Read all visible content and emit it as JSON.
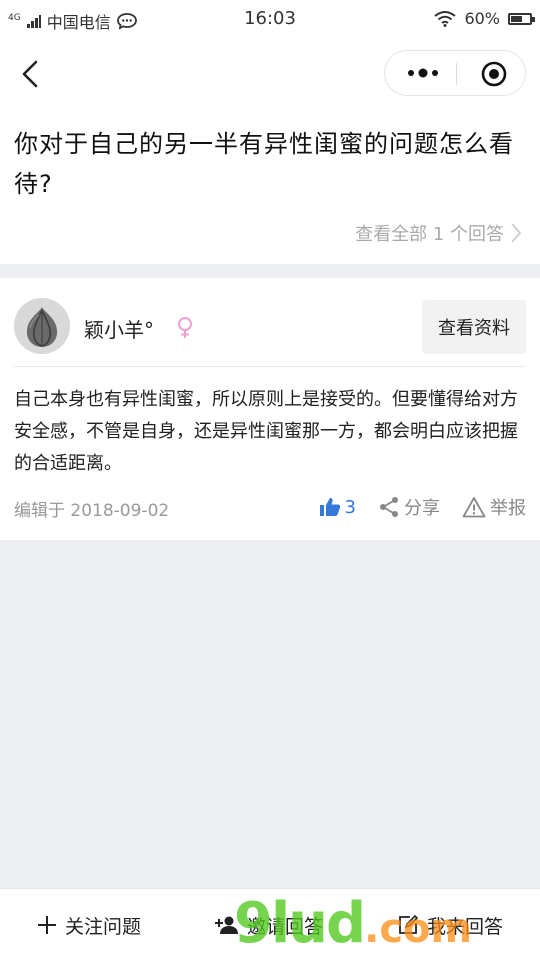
{
  "status_bar": {
    "network": "4G",
    "carrier": "中国电信",
    "time": "16:03",
    "battery": "60%",
    "battery_level": 0.6
  },
  "question": {
    "title": "你对于自己的另一半有异性闺蜜的问题怎么看待?",
    "all_answers_label": "查看全部 1 个回答"
  },
  "answer": {
    "author_name": "颖小羊°",
    "profile_button": "查看资料",
    "content": "自己本身也有异性闺蜜，所以原则上是接受的。但要懂得给对方安全感，不管是自身，还是异性闺蜜那一方，都会明白应该把握的合适距离。",
    "edited_label": "编辑于 2018-09-02",
    "likes": "3",
    "share_label": "分享",
    "report_label": "举报"
  },
  "bottom_bar": {
    "follow_label": "关注问题",
    "invite_label": "邀请回答",
    "answer_label": "我来回答"
  },
  "watermark": {
    "brand": "9lud",
    "suffix": ".com"
  },
  "colors": {
    "accent_like": "#3478d8",
    "muted_text": "#999999",
    "page_bg": "#eeeff2"
  }
}
